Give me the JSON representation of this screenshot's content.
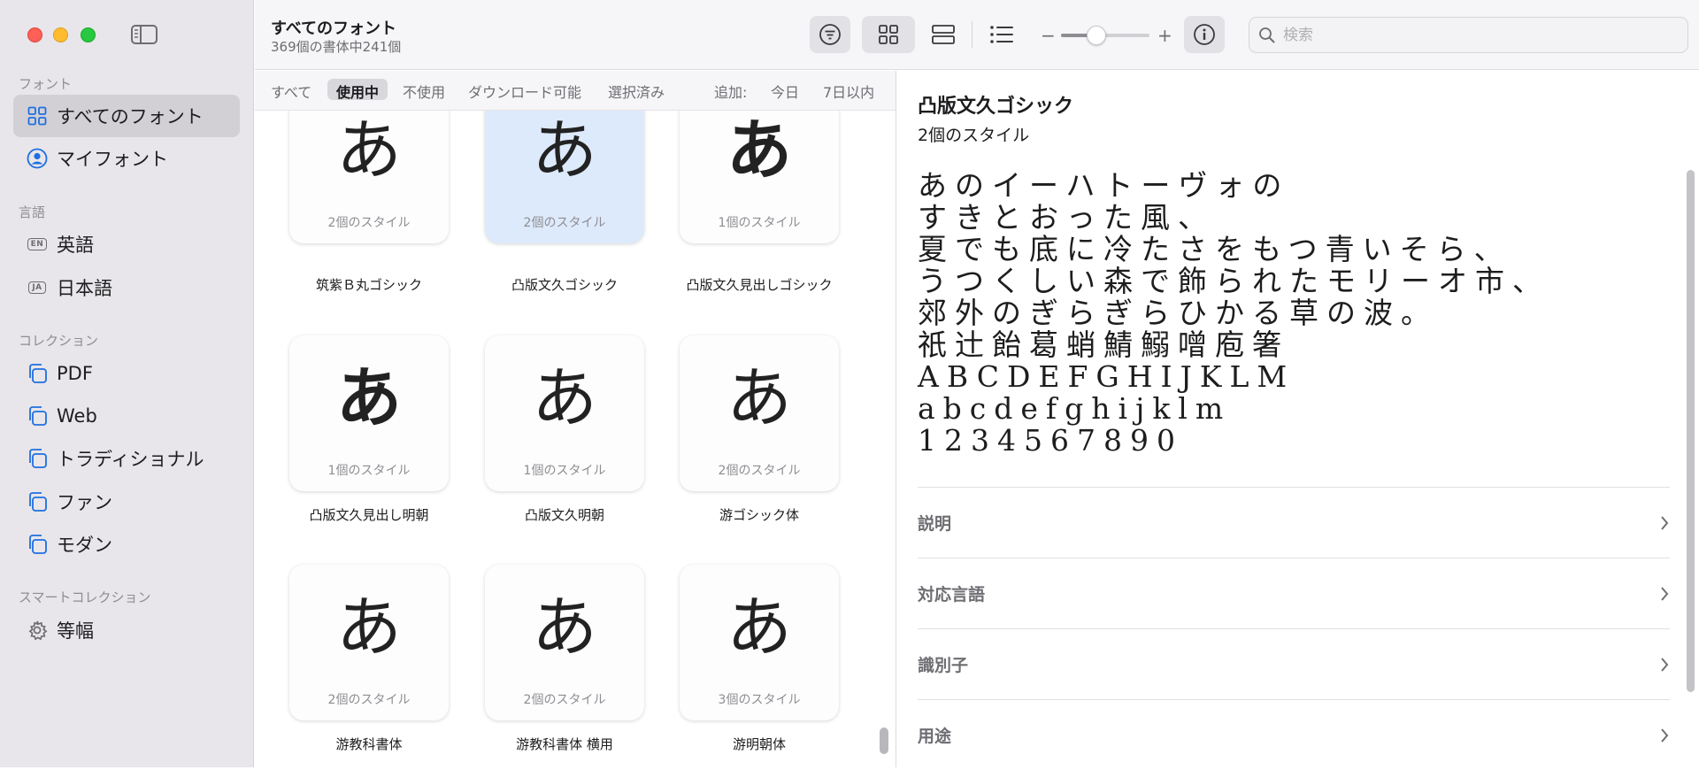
{
  "sidebar": {
    "sections": {
      "fonts": "フォント",
      "languages": "言語",
      "collections": "コレクション",
      "smart": "スマートコレクション"
    },
    "items": {
      "all_fonts": "すべてのフォント",
      "my_fonts": "マイフォント",
      "english": "英語",
      "english_badge": "EN",
      "japanese": "日本語",
      "japanese_badge": "JA",
      "pdf": "PDF",
      "web": "Web",
      "traditional": "トラディショナル",
      "fun": "ファン",
      "modern": "モダン",
      "monospace": "等幅"
    }
  },
  "toolbar": {
    "title": "すべてのフォント",
    "subtitle": "369個の書体中241個",
    "slider_minus": "−",
    "slider_plus": "+",
    "slider_value": 0.4,
    "search_placeholder": "検索"
  },
  "filters": {
    "all": "すべて",
    "in_use": "使用中",
    "not_in_use": "不使用",
    "downloadable": "ダウンロード可能",
    "selected": "選択済み",
    "added": "追加:",
    "today": "今日",
    "within7": "7日以内"
  },
  "grid": {
    "tiles": [
      {
        "glyph": "あ",
        "styles": "2個のスタイル",
        "name": "筑紫Ｂ丸ゴシック"
      },
      {
        "glyph": "あ",
        "styles": "2個のスタイル",
        "name": "凸版文久ゴシック"
      },
      {
        "glyph": "あ",
        "styles": "1個のスタイル",
        "name": "凸版文久見出しゴシック"
      },
      {
        "glyph": "あ",
        "styles": "1個のスタイル",
        "name": "凸版文久見出し明朝"
      },
      {
        "glyph": "あ",
        "styles": "1個のスタイル",
        "name": "凸版文久明朝"
      },
      {
        "glyph": "あ",
        "styles": "2個のスタイル",
        "name": "游ゴシック体"
      },
      {
        "glyph": "あ",
        "styles": "2個のスタイル",
        "name": "游教科書体"
      },
      {
        "glyph": "あ",
        "styles": "2個のスタイル",
        "name": "游教科書体 横用"
      },
      {
        "glyph": "あ",
        "styles": "3個のスタイル",
        "name": "游明朝体"
      }
    ]
  },
  "detail": {
    "title": "凸版文久ゴシック",
    "subtitle": "2個のスタイル",
    "sample": [
      "あのイーハトーヴォの",
      "すきとおった風、",
      "夏でも底に冷たさをもつ青いそら、",
      "うつくしい森で飾られたモリーオ市、",
      "郊外のぎらぎらひかる草の波。",
      "祇辻飴葛蛸鯖鰯噌庖箸",
      "ABCDEFGHIJKLM",
      "abcdefghijklm",
      "1234567890"
    ],
    "rows": {
      "description": "説明",
      "languages": "対応言語",
      "identifier": "識別子",
      "usage": "用途"
    }
  }
}
